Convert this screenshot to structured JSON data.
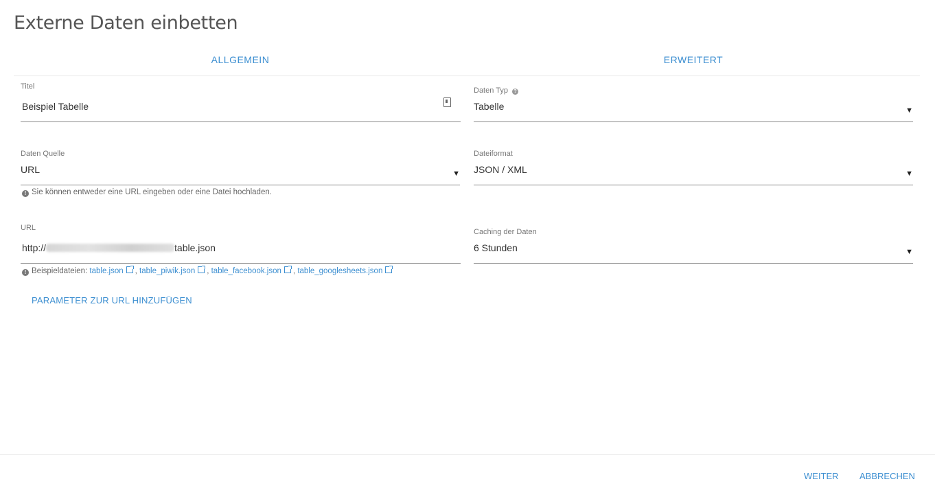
{
  "dialog": {
    "title": "Externe Daten einbetten"
  },
  "tabs": [
    {
      "label": "ALLGEMEIN"
    },
    {
      "label": "ERWEITERT"
    }
  ],
  "left": {
    "titel": {
      "label": "Titel",
      "value": "Beispiel Tabelle",
      "icon": "contact-card-icon"
    },
    "quelle": {
      "label": "Daten Quelle",
      "value": "URL",
      "hint": "Sie können entweder eine URL eingeben oder eine Datei hochladen."
    },
    "url": {
      "label": "URL",
      "prefix": "http://",
      "suffix": "table.json",
      "hint_prefix": "Beispieldateien:",
      "examples": [
        "table.json",
        "table_piwik.json",
        "table_facebook.json",
        "table_googlesheets.json"
      ]
    },
    "add_param_label": "PARAMETER ZUR URL HINZUFÜGEN"
  },
  "right": {
    "typ": {
      "label": "Daten Typ",
      "value": "Tabelle"
    },
    "format": {
      "label": "Dateiformat",
      "value": "JSON / XML"
    },
    "caching": {
      "label": "Caching der Daten",
      "value": "6 Stunden"
    }
  },
  "footer": {
    "next_label": "WEITER",
    "cancel_label": "ABBRECHEN"
  },
  "colors": {
    "accent": "#3d8fd1"
  }
}
